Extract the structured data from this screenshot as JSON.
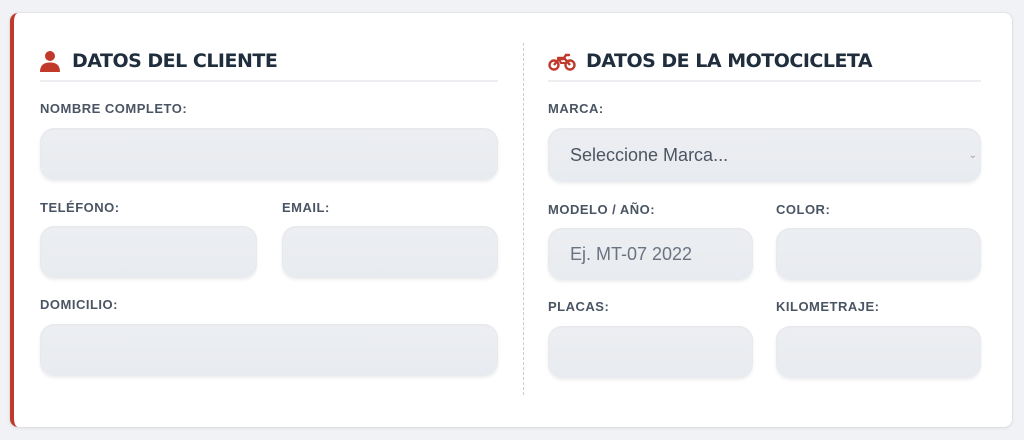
{
  "client": {
    "title": "DATOS DEL CLIENTE",
    "icon": "user-icon",
    "fields": {
      "name_label": "NOMBRE COMPLETO:",
      "name_value": "",
      "phone_label": "TELÉFONO:",
      "phone_value": "",
      "email_label": "EMAIL:",
      "email_value": "",
      "address_label": "DOMICILIO:",
      "address_value": ""
    }
  },
  "motorcycle": {
    "title": "DATOS DE LA MOTOCICLETA",
    "icon": "motorcycle-icon",
    "fields": {
      "brand_label": "MARCA:",
      "brand_selected": "Seleccione Marca...",
      "model_label": "MODELO / AÑO:",
      "model_placeholder": "Ej. MT-07 2022",
      "color_label": "COLOR:",
      "color_value": "",
      "plates_label": "PLACAS:",
      "plates_value": "",
      "mileage_label": "KILOMETRAJE:",
      "mileage_value": ""
    }
  },
  "colors": {
    "accent": "#c0392b",
    "title": "#1f2d3d",
    "field_bg": "#eceef2"
  }
}
